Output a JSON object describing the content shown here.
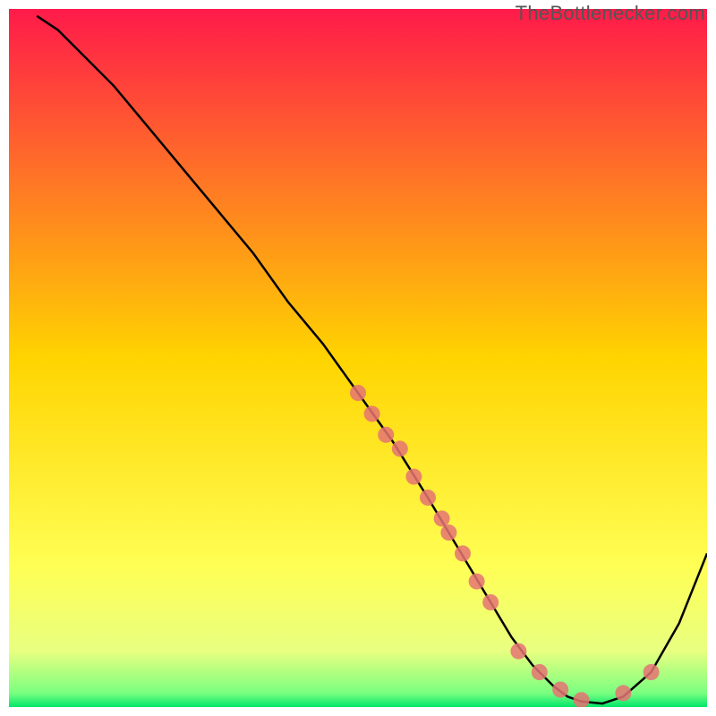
{
  "watermark": "TheBottlenecker.com",
  "chart_data": {
    "type": "line",
    "title": "",
    "xlabel": "",
    "ylabel": "",
    "xlim": [
      0,
      100
    ],
    "ylim": [
      0,
      100
    ],
    "axes_visible": false,
    "grid": false,
    "background_gradient": {
      "stops": [
        {
          "offset": 0.0,
          "color": "#ff1a4a"
        },
        {
          "offset": 0.5,
          "color": "#ffd400"
        },
        {
          "offset": 0.8,
          "color": "#ffff55"
        },
        {
          "offset": 0.92,
          "color": "#e8ff80"
        },
        {
          "offset": 0.98,
          "color": "#7aff80"
        },
        {
          "offset": 1.0,
          "color": "#00e66a"
        }
      ]
    },
    "series": [
      {
        "name": "curve",
        "type": "line",
        "color": "#000000",
        "x": [
          4,
          7,
          10,
          15,
          20,
          25,
          30,
          35,
          40,
          45,
          50,
          55,
          60,
          63,
          66,
          69,
          72,
          75,
          78,
          80,
          82,
          85,
          88,
          92,
          96,
          100
        ],
        "y": [
          99,
          97,
          94,
          89,
          83,
          77,
          71,
          65,
          58,
          52,
          45,
          38,
          30,
          25,
          20,
          15,
          10,
          6,
          3,
          1.5,
          0.8,
          0.5,
          1.5,
          5,
          12,
          22
        ]
      },
      {
        "name": "markers",
        "type": "scatter",
        "color": "#e57373",
        "radius": 9,
        "x": [
          50,
          52,
          54,
          56,
          58,
          60,
          62,
          63,
          65,
          67,
          69,
          73,
          76,
          79,
          82,
          88,
          92
        ],
        "y": [
          45,
          42,
          39,
          37,
          33,
          30,
          27,
          25,
          22,
          18,
          15,
          8,
          5,
          2.5,
          1,
          2,
          5
        ]
      }
    ]
  }
}
